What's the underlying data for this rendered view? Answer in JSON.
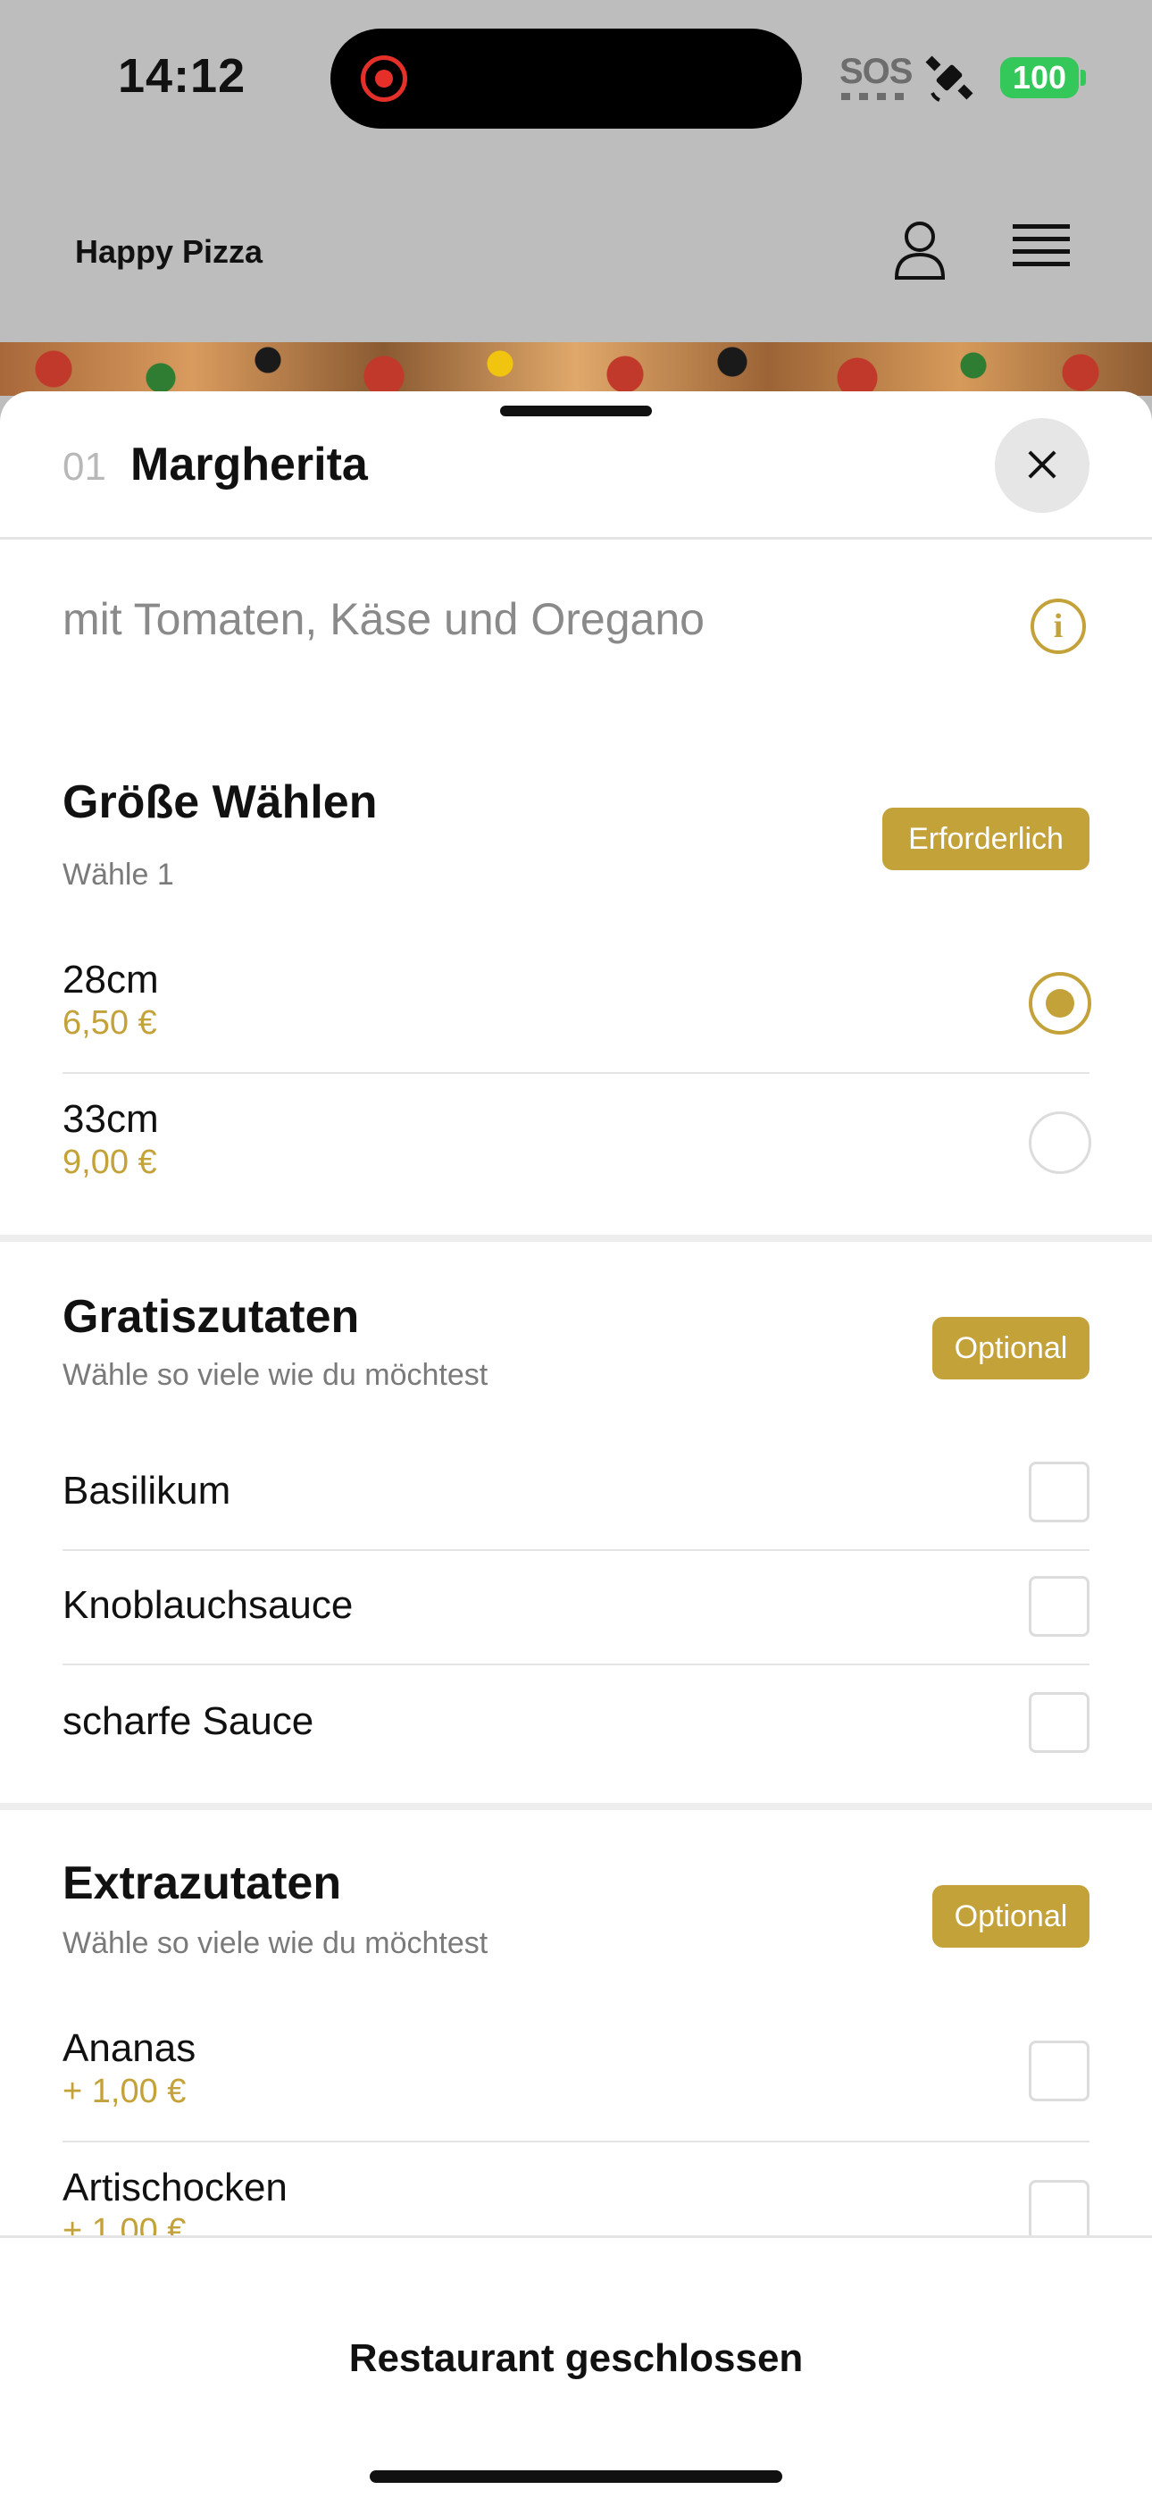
{
  "status_bar": {
    "time": "14:12",
    "sos": "SOS",
    "battery": "100"
  },
  "header": {
    "brand": "Happy Pizza"
  },
  "item": {
    "number": "01",
    "title": "Margherita",
    "description": "mit Tomaten, Käse und Oregano"
  },
  "groups": {
    "size": {
      "title": "Größe Wählen",
      "subtitle": "Wähle 1",
      "badge": "Erforderlich",
      "options": [
        {
          "label": "28cm",
          "price": "6,50 €",
          "selected": true
        },
        {
          "label": "33cm",
          "price": "9,00 €",
          "selected": false
        }
      ]
    },
    "free": {
      "title": "Gratiszutaten",
      "subtitle": "Wähle so viele wie du möchtest",
      "badge": "Optional",
      "options": [
        {
          "label": "Basilikum"
        },
        {
          "label": "Knoblauchsauce"
        },
        {
          "label": "scharfe Sauce"
        }
      ]
    },
    "extra": {
      "title": "Extrazutaten",
      "subtitle": "Wähle so viele wie du möchtest",
      "badge": "Optional",
      "options": [
        {
          "label": "Ananas",
          "price": "+ 1,00 €"
        },
        {
          "label": "Artischocken",
          "price": "+ 1,00 €"
        }
      ]
    }
  },
  "footer": {
    "status": "Restaurant geschlossen"
  },
  "colors": {
    "accent": "#c4a23a",
    "battery": "#34c759",
    "record": "#e5302a"
  }
}
